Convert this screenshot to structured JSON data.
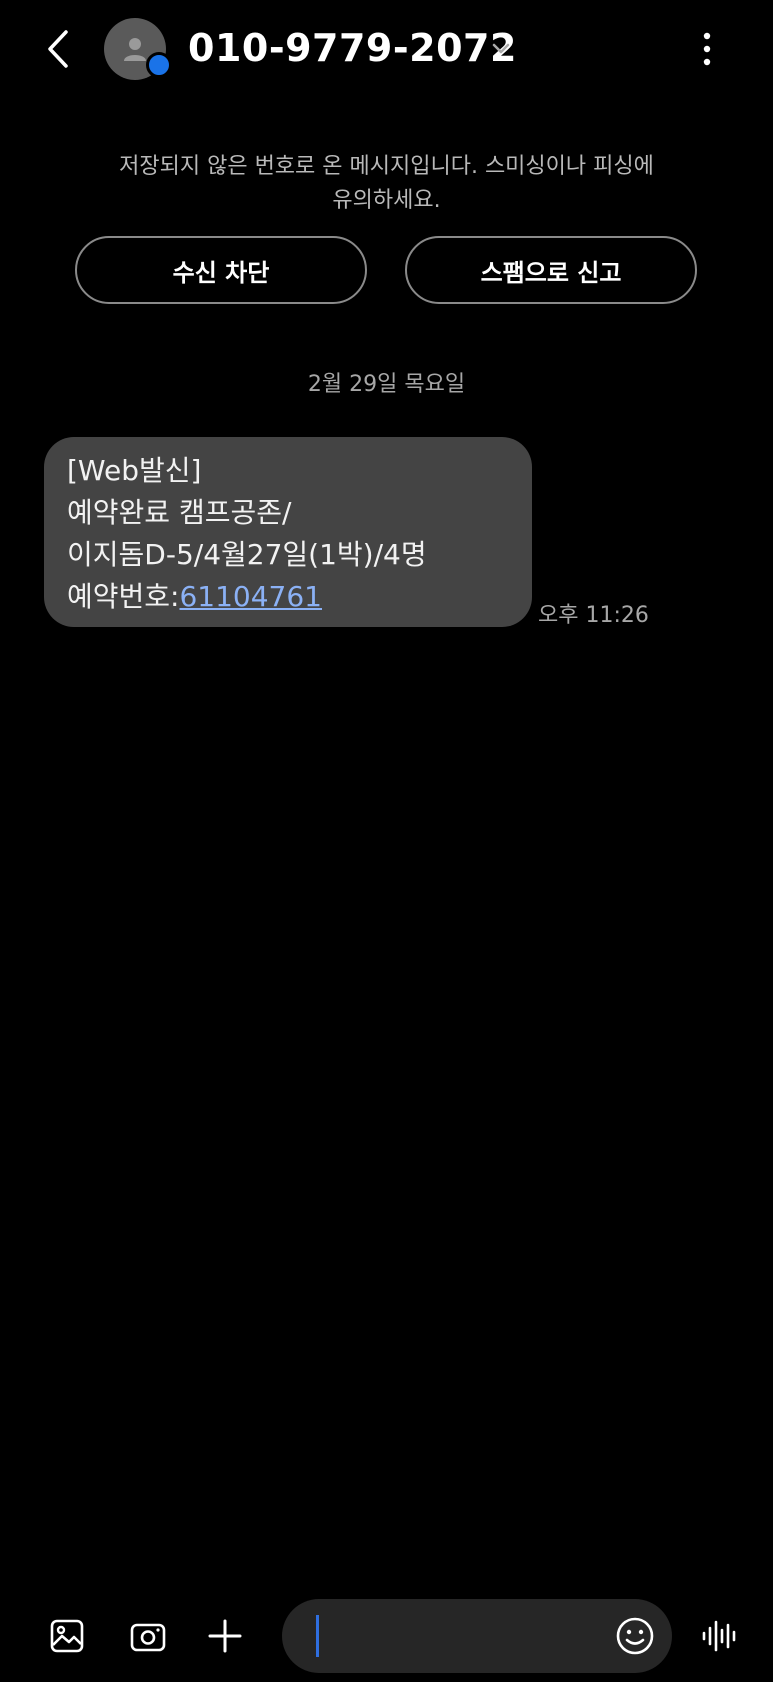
{
  "header": {
    "contact_number": "010-9779-2072",
    "icons": {
      "back": "chevron-left-icon",
      "avatar": "person-icon",
      "expand": "chevron-down-icon",
      "more": "more-vertical-icon"
    }
  },
  "notice": {
    "text_line1": "저장되지 않은 번호로 온 메시지입니다. 스미싱이나 피싱에",
    "text_line2": "유의하세요.",
    "block_label": "수신 차단",
    "spam_label": "스팸으로 신고"
  },
  "conversation": {
    "date_label": "2월 29일 목요일",
    "messages": [
      {
        "lines": [
          "[Web발신]",
          "예약완료 캠프공존/",
          "이지돔D-5/4월27일(1박)/4명"
        ],
        "reservation_prefix": "예약번호:",
        "reservation_number": "61104761",
        "time": "오후 11:26"
      }
    ]
  },
  "composer": {
    "value": "",
    "icons": {
      "gallery": "image-icon",
      "camera": "camera-icon",
      "add": "plus-icon",
      "emoji": "smiley-icon",
      "voice": "voice-waveform-icon"
    }
  },
  "colors": {
    "background": "#000000",
    "bubble": "#444444",
    "link": "#8bb1f5",
    "badge": "#1a73e8",
    "composer": "#262626"
  }
}
